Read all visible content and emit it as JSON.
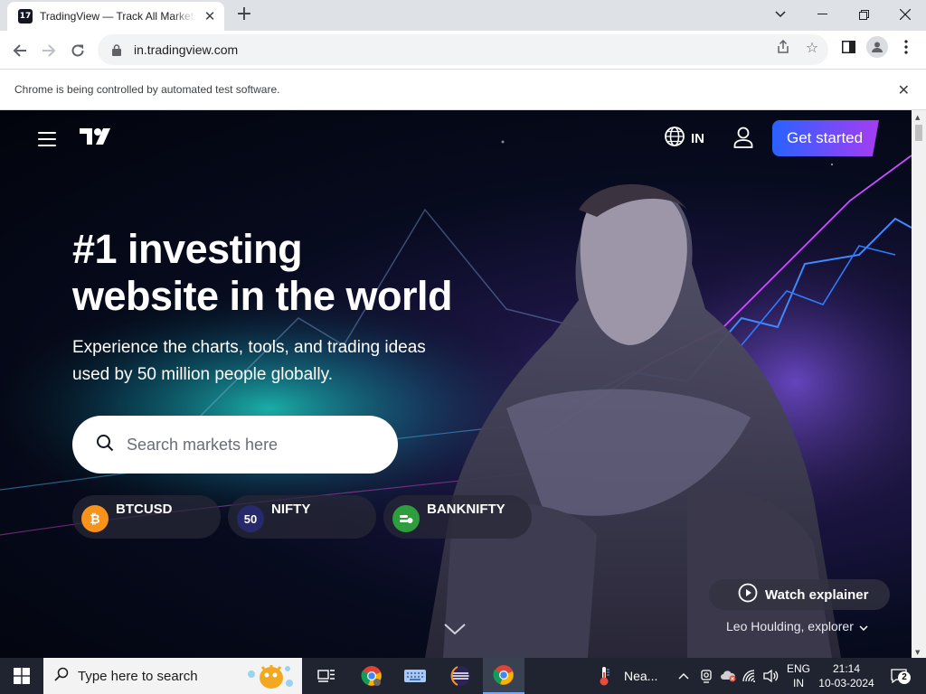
{
  "browser": {
    "tab": {
      "title": "TradingView — Track All Markets",
      "favicon_text": "17"
    },
    "url": "in.tradingview.com",
    "infobar_text": "Chrome is being controlled by automated test software."
  },
  "page": {
    "lang_label": "IN",
    "cta_label": "Get started",
    "headline_line1": "#1 investing",
    "headline_line2": "website in the world",
    "subline_line1": "Experience the charts, tools, and trading ideas",
    "subline_line2": "used by 50 million people globally.",
    "search_placeholder": "Search markets here",
    "tickers": [
      {
        "name": "BTCUSD",
        "icon": "bitcoin-icon",
        "color": "#f7931a"
      },
      {
        "name": "NIFTY",
        "icon_text": "50",
        "color": "#262a6c"
      },
      {
        "name": "BANKNIFTY",
        "icon": "banknifty-icon",
        "color": "#2e9d3d"
      }
    ],
    "watch_label": "Watch explainer",
    "credit": "Leo Houlding, explorer",
    "accent_gradient": [
      "#2962ff",
      "#a63cf2"
    ]
  },
  "taskbar": {
    "search_text": "Type here to search",
    "weather": "Nea...",
    "lang_line1": "ENG",
    "lang_line2": "IN",
    "time": "21:14",
    "date": "10-03-2024",
    "notifications": "2"
  }
}
